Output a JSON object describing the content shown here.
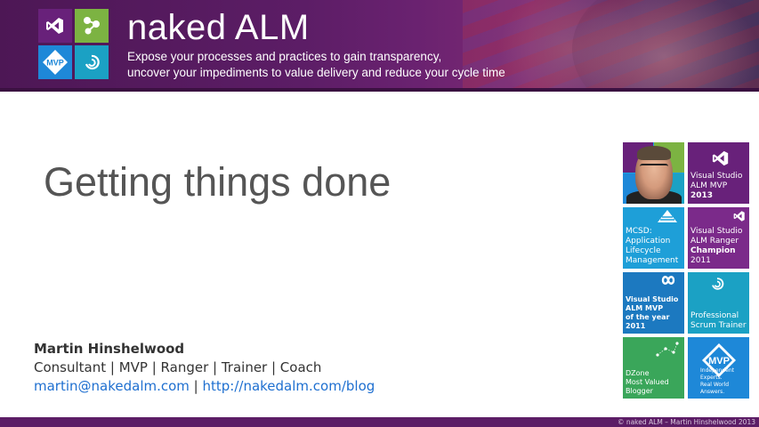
{
  "header": {
    "title": "naked ALM",
    "tagline_line1": "Expose your processes and practices to gain transparency,",
    "tagline_line2": "uncover your impediments to value delivery and reduce your cycle time",
    "logo_tiles": [
      {
        "icon": "visual-studio-icon",
        "color": "#68217a"
      },
      {
        "icon": "connected-nodes-icon",
        "color": "#7cb342"
      },
      {
        "icon": "mvp-badge-icon",
        "color": "#1e88d8",
        "label": "MVP"
      },
      {
        "icon": "scrum-swirl-icon",
        "color": "#1ba1c4"
      }
    ]
  },
  "slide": {
    "title": "Getting things done"
  },
  "presenter": {
    "name": "Martin Hinshelwood",
    "roles": "Consultant | MVP | Ranger | Trainer | Coach",
    "email": "martin@nakedalm.com",
    "separator": " | ",
    "blog": "http://nakedalm.com/blog"
  },
  "tiles": {
    "vs_mvp_2013": {
      "line1": "Visual Studio",
      "line2": "ALM MVP",
      "line3": "2013"
    },
    "mcsd": {
      "line1": "MCSD:",
      "line2": "Application",
      "line3": "Lifecycle",
      "line4": "Management"
    },
    "ranger": {
      "line1": "Visual Studio",
      "line2": "ALM Ranger",
      "line3": "Champion",
      "line4": "2011"
    },
    "mvp_year": {
      "line1": "Visual Studio",
      "line2": "ALM MVP",
      "line3": "of the year",
      "line4": "2011"
    },
    "pst": {
      "line1": "Professional",
      "line2": "Scrum Trainer"
    },
    "dzone": {
      "line1": "DZone",
      "line2": "Most Valued",
      "line3": "Blogger"
    },
    "mvp": {
      "badge": "MVP",
      "line1": "Independent Experts.",
      "line2": "Real World Answers."
    }
  },
  "footer": {
    "copyright": "© naked ALM – Martin Hinshelwood 2013"
  },
  "colors": {
    "banner": "#5c1d66",
    "link": "#1e6fd0",
    "title_text": "#555555"
  }
}
